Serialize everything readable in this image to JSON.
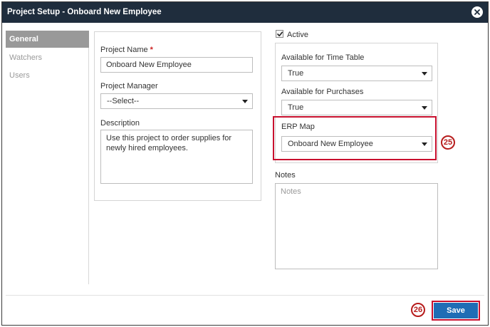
{
  "window": {
    "title": "Project Setup - Onboard New Employee"
  },
  "sidebar": {
    "items": [
      {
        "label": "General",
        "active": true
      },
      {
        "label": "Watchers",
        "active": false
      },
      {
        "label": "Users",
        "active": false
      }
    ]
  },
  "form": {
    "project_name_label": "Project Name",
    "required_mark": "*",
    "project_name_value": "Onboard New Employee",
    "project_manager_label": "Project Manager",
    "project_manager_value": "--Select--",
    "description_label": "Description",
    "description_value": "Use this project to order supplies for newly hired employees."
  },
  "options": {
    "active_label": "Active",
    "active_checked": true,
    "time_table_label": "Available for Time Table",
    "time_table_value": "True",
    "purchases_label": "Available for Purchases",
    "purchases_value": "True",
    "erp_map_label": "ERP Map",
    "erp_map_value": "Onboard New Employee",
    "notes_label": "Notes",
    "notes_placeholder": "Notes"
  },
  "callouts": {
    "erp": "25",
    "save": "26"
  },
  "footer": {
    "save_label": "Save"
  },
  "colors": {
    "titlebar": "#1f2d3d",
    "accent": "#1f6db5",
    "highlight": "#c8102e"
  }
}
